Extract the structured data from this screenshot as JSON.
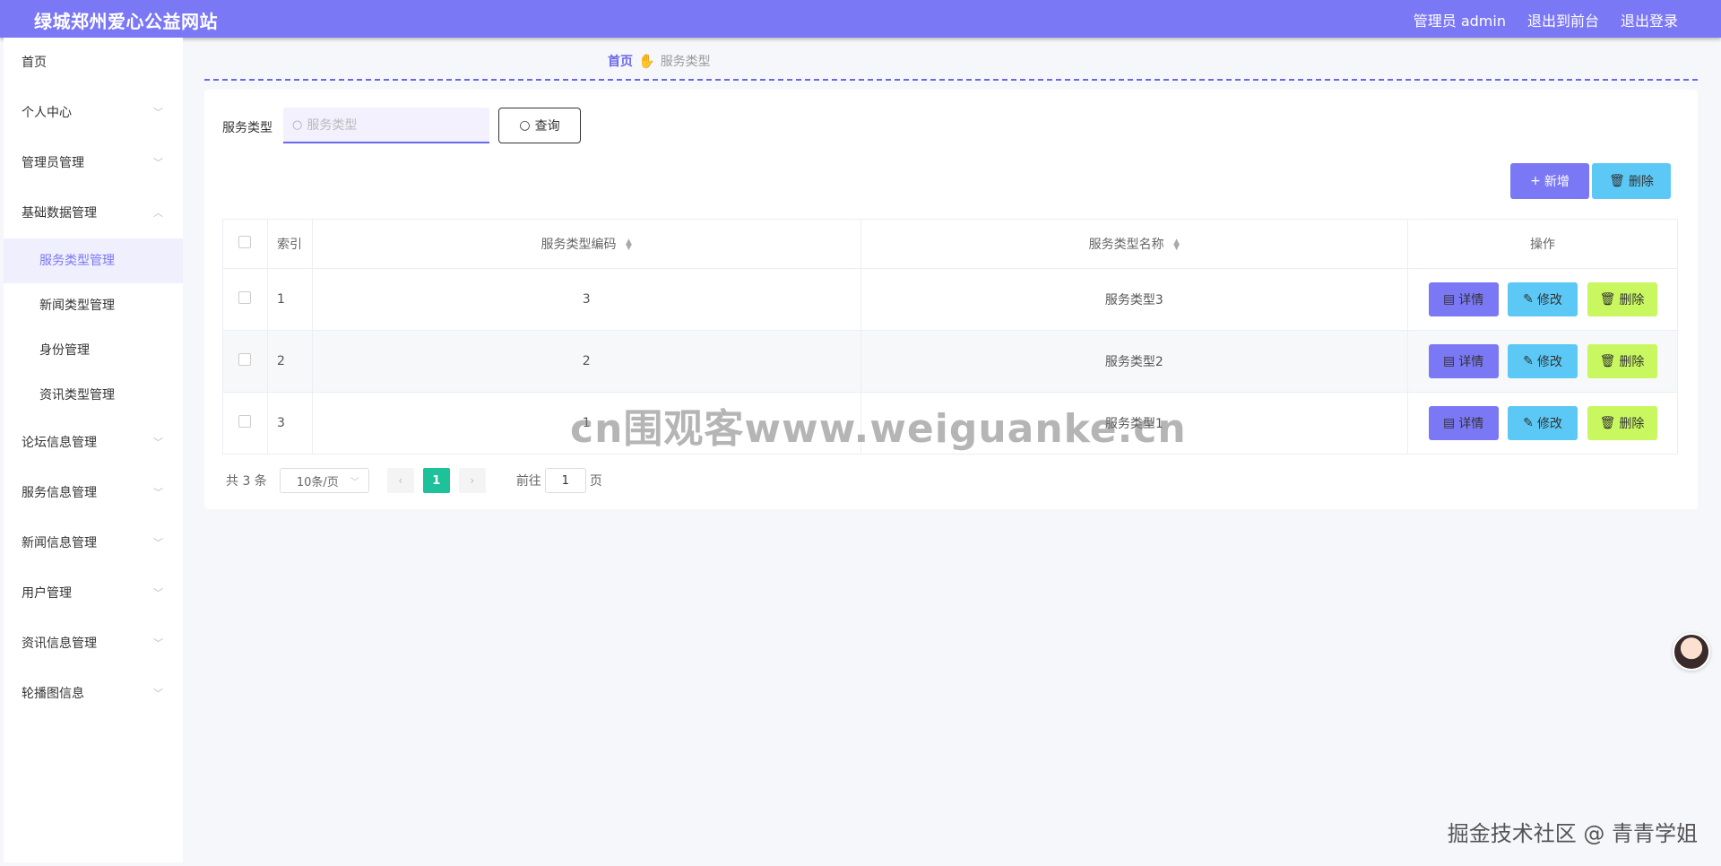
{
  "header": {
    "site_title": "绿城郑州爱心公益网站",
    "admin_label": "管理员 admin",
    "back_to_front": "退出到前台",
    "logout": "退出登录"
  },
  "sidebar": {
    "items": [
      {
        "label": "首页"
      },
      {
        "label": "个人中心"
      },
      {
        "label": "管理员管理"
      },
      {
        "label": "基础数据管理"
      },
      {
        "label": "论坛信息管理"
      },
      {
        "label": "服务信息管理"
      },
      {
        "label": "新闻信息管理"
      },
      {
        "label": "用户管理"
      },
      {
        "label": "资讯信息管理"
      },
      {
        "label": "轮播图信息"
      }
    ],
    "submenu": [
      {
        "label": "服务类型管理"
      },
      {
        "label": "新闻类型管理"
      },
      {
        "label": "身份管理"
      },
      {
        "label": "资讯类型管理"
      }
    ]
  },
  "breadcrumb": {
    "home": "首页",
    "current": "服务类型"
  },
  "search": {
    "label": "服务类型",
    "placeholder": "服务类型",
    "query_button": "查询"
  },
  "actions": {
    "add": "新增",
    "delete": "删除"
  },
  "table": {
    "headers": {
      "index": "索引",
      "code": "服务类型编码",
      "name": "服务类型名称",
      "ops": "操作"
    },
    "rows": [
      {
        "index": "1",
        "code": "3",
        "name": "服务类型3"
      },
      {
        "index": "2",
        "code": "2",
        "name": "服务类型2"
      },
      {
        "index": "3",
        "code": "1",
        "name": "服务类型1"
      }
    ],
    "op_labels": {
      "detail": "详情",
      "edit": "修改",
      "delete": "删除"
    }
  },
  "pagination": {
    "total": "共 3 条",
    "page_size": "10条/页",
    "current_page": "1",
    "goto_prefix": "前往",
    "goto_value": "1",
    "goto_suffix": "页"
  },
  "watermark": "cn围观客www.weiguanke.cn",
  "credit": "掘金技术社区 @ 青青学姐",
  "colors": {
    "primary": "#7b78f5",
    "info": "#5bc8f5",
    "lime": "#c9f760",
    "page_active": "#1ec29a"
  }
}
